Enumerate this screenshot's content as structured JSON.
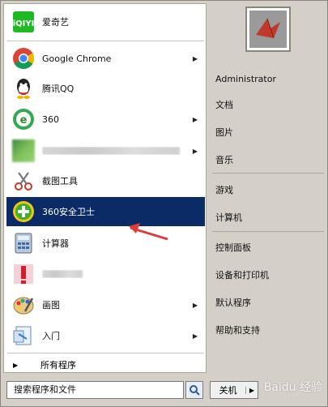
{
  "left_items": [
    {
      "label": "爱奇艺",
      "icon": "iqiyi-icon",
      "arrow": ""
    },
    {
      "label": "Google Chrome",
      "icon": "chrome-icon",
      "arrow": "▶"
    },
    {
      "label": "腾讯QQ",
      "icon": "qq-icon",
      "arrow": ""
    },
    {
      "label": "360",
      "icon": "360-browser-icon",
      "arrow": "▶"
    },
    {
      "label": "",
      "icon": "blurred-app-icon",
      "arrow": "▶"
    },
    {
      "label": "截图工具",
      "icon": "snipping-tool-icon",
      "arrow": ""
    },
    {
      "label": "360安全卫士",
      "icon": "360-security-icon",
      "arrow": ""
    },
    {
      "label": "计算器",
      "icon": "calculator-icon",
      "arrow": ""
    },
    {
      "label": "",
      "icon": "blurred-app-icon-2",
      "arrow": ""
    },
    {
      "label": "画图",
      "icon": "paint-icon",
      "arrow": "▶"
    },
    {
      "label": "入门",
      "icon": "getting-started-icon",
      "arrow": "▶"
    }
  ],
  "all_programs": "所有程序",
  "right_items": [
    {
      "label": "Administrator"
    },
    {
      "label": "文档"
    },
    {
      "label": "图片"
    },
    {
      "label": "音乐"
    },
    {
      "label": "游戏"
    },
    {
      "label": "计算机"
    },
    {
      "label": "控制面板"
    },
    {
      "label": "设备和打印机"
    },
    {
      "label": "默认程序"
    },
    {
      "label": "帮助和支持"
    }
  ],
  "search": {
    "placeholder": "搜索程序和文件"
  },
  "shutdown": {
    "label": "关机",
    "more": "▶"
  },
  "watermark": "Baidu 经验",
  "colors": {
    "selected": "#0b2b66",
    "pointer": "#e33b3b"
  }
}
